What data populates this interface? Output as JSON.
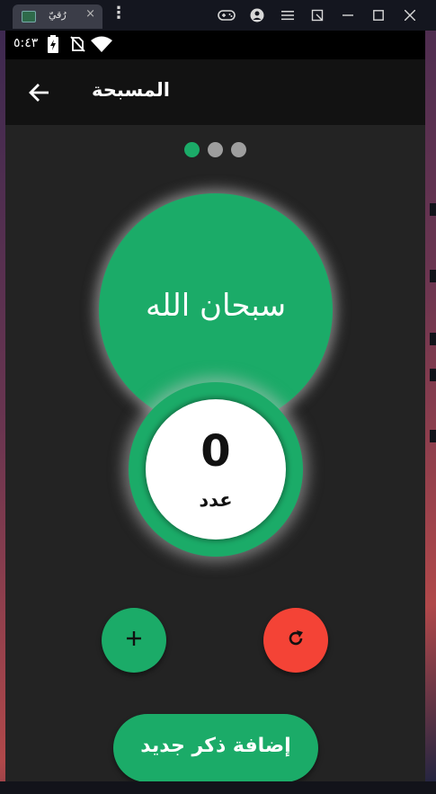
{
  "host": {
    "tab_title": "رُقيّ",
    "tab_close": "×",
    "menu_glyph": "⋮"
  },
  "status_bar": {
    "time": "٥:٤٣"
  },
  "app_bar": {
    "title": "المسبحة"
  },
  "pager": {
    "page_count": 3,
    "active_index": 0
  },
  "dhikr": {
    "text": "سبحان الله"
  },
  "counter": {
    "value": "0",
    "label": "عدد"
  },
  "actions": {
    "add_new_dhikr_label": "إضافة ذكر جديد"
  },
  "colors": {
    "accent": "#1bab68",
    "reset": "#f44336",
    "background": "#232323",
    "app_bar": "#121212"
  }
}
